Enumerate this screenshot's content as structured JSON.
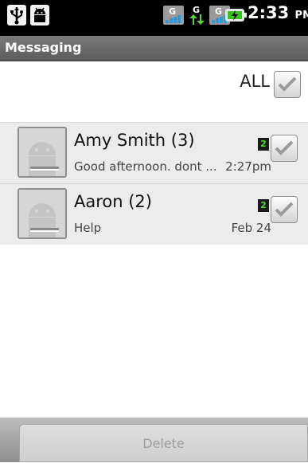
{
  "status_bar": {
    "time": "2:33",
    "ampm": "PM",
    "icons": [
      "usb-icon",
      "android-debug-icon",
      "signal-g-icon",
      "data-transfer-icon",
      "signal-g-icon",
      "battery-charging-icon"
    ]
  },
  "title": "Messaging",
  "select_all": {
    "label": "ALL",
    "checked": false
  },
  "messages": [
    {
      "name": "Amy Smith (3)",
      "snippet": "Good afternoon. dont ...",
      "time": "2:27pm",
      "sim": "2",
      "checked": false
    },
    {
      "name": "Aaron (2)",
      "snippet": "Help",
      "time": "Feb 24",
      "sim": "2",
      "checked": false
    }
  ],
  "bottom": {
    "delete_label": "Delete"
  },
  "colors": {
    "title_bar": "#6b6b6b",
    "row_background": "#ececec",
    "sim_badge_text": "#46e01a",
    "battery": "#38c11a"
  }
}
